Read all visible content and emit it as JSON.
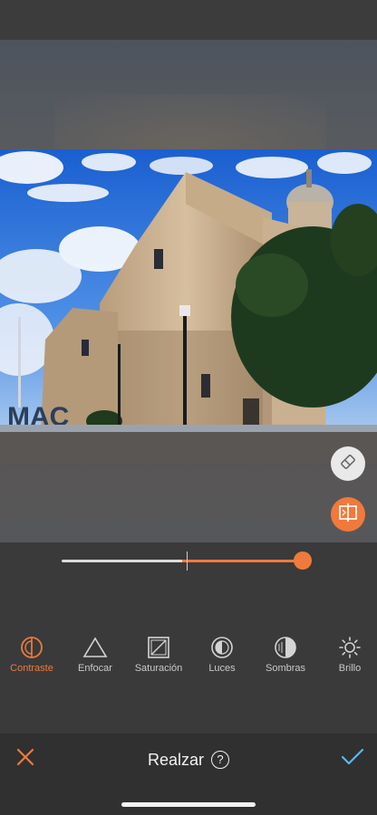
{
  "colors": {
    "accent": "#ef7a3c",
    "background": "#3a3a3a",
    "bottom_bar": "#303030",
    "check": "#5fb6e8"
  },
  "editor": {
    "photo_description_icon": "photo-preview",
    "eraser_icon": "eraser-icon",
    "compare_icon": "compare-icon"
  },
  "slider": {
    "value_fraction": 1.0,
    "center_fraction": 0.5
  },
  "tools": [
    {
      "label": "Contraste",
      "icon": "contrast-icon",
      "active": true
    },
    {
      "label": "Enfocar",
      "icon": "triangle-icon",
      "active": false
    },
    {
      "label": "Saturación",
      "icon": "saturation-icon",
      "active": false
    },
    {
      "label": "Luces",
      "icon": "highlights-icon",
      "active": false
    },
    {
      "label": "Sombras",
      "icon": "shadows-icon",
      "active": false
    },
    {
      "label": "Brillo",
      "icon": "sun-icon",
      "active": false
    }
  ],
  "bottom_bar": {
    "title": "Realzar",
    "help": "?",
    "cancel_icon": "close-icon",
    "confirm_icon": "check-icon"
  }
}
